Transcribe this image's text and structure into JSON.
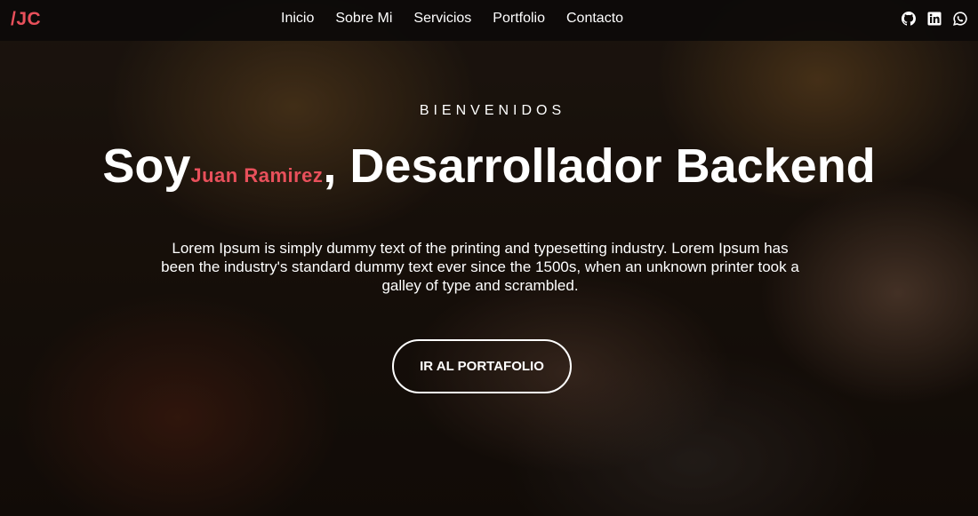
{
  "navbar": {
    "brand": "/JC",
    "links": [
      "Inicio",
      "Sobre Mi",
      "Servicios",
      "Portfolio",
      "Contacto"
    ],
    "social_icons": [
      "github-icon",
      "linkedin-icon",
      "whatsapp-icon"
    ]
  },
  "hero": {
    "eyebrow": "BIENVENIDOS",
    "headline_prefix": "Soy",
    "name": "Juan Ramirez",
    "headline_suffix": ", Desarrollador Backend",
    "lead": "Lorem Ipsum is simply dummy text of the printing and typesetting industry. Lorem Ipsum has been the industry's standard dummy text ever since the 1500s, when an unknown printer took a galley of type and scrambled.",
    "cta_label": "IR AL PORTAFOLIO"
  },
  "colors": {
    "accent": "#e8505b",
    "navbar_bg": "#0c0a09",
    "text": "#ffffff"
  }
}
